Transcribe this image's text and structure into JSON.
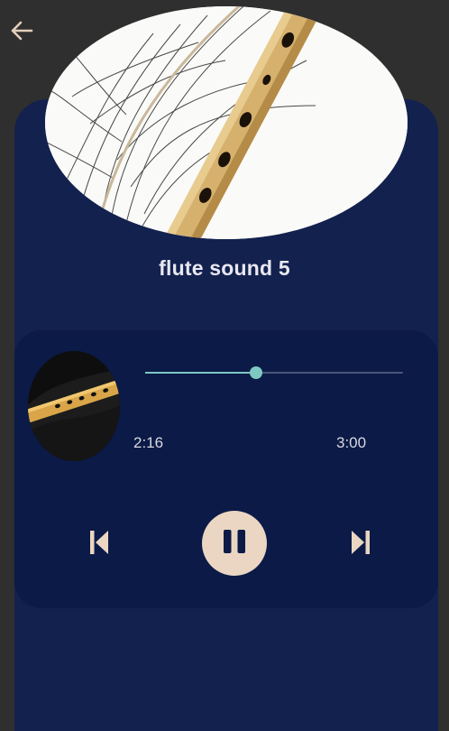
{
  "nav": {
    "back_icon": "arrow-left-icon"
  },
  "track": {
    "title": "flute sound 5",
    "elapsed": "2:16",
    "duration": "3:00",
    "progress": 0.43
  },
  "controls": {
    "previous_icon": "skip-previous-icon",
    "pause_icon": "pause-icon",
    "next_icon": "skip-next-icon"
  },
  "colors": {
    "background": "#2f2f2f",
    "card": "#13214f",
    "player_panel": "#0b1a47",
    "accent": "#7ec8c4",
    "play_button": "#ead6c2"
  }
}
